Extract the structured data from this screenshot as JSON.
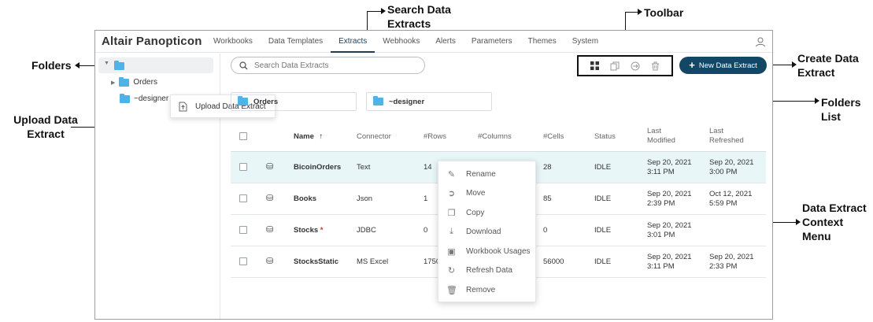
{
  "callouts": {
    "search": "Search Data Extracts",
    "toolbar": "Toolbar",
    "folders": "Folders",
    "create": "Create Data Extract",
    "upload": "Upload Data Extract",
    "folders_list": "Folders List",
    "context_menu": "Data Extract Context Menu"
  },
  "app": {
    "brand": "Altair Panopticon",
    "nav": [
      "Workbooks",
      "Data Templates",
      "Extracts",
      "Webhooks",
      "Alerts",
      "Parameters",
      "Themes",
      "System"
    ],
    "active_nav": "Extracts"
  },
  "sidebar": {
    "folders": [
      "Orders",
      "~designer"
    ]
  },
  "upload_menu": {
    "label": "Upload Data Extract"
  },
  "search": {
    "placeholder": "Search Data Extracts"
  },
  "new_button": {
    "label": "New Data Extract"
  },
  "folder_cards": [
    "Orders",
    "~designer"
  ],
  "table": {
    "headers": {
      "name": "Name",
      "connector": "Connector",
      "rows": "#Rows",
      "columns": "#Columns",
      "cells": "#Cells",
      "status": "Status",
      "last_modified_1": "Last",
      "last_modified_2": "Modified",
      "last_refreshed_1": "Last",
      "last_refreshed_2": "Refreshed"
    },
    "rows": [
      {
        "name": "BicoinOrders",
        "connector": "Text",
        "rows": "14",
        "cells": "28",
        "status": "IDLE",
        "modified_date": "Sep 20, 2021",
        "modified_time": "3:11 PM",
        "refreshed_date": "Sep 20, 2021",
        "refreshed_time": "3:00 PM"
      },
      {
        "name": "Books",
        "connector": "Json",
        "rows": "1",
        "cells": "85",
        "status": "IDLE",
        "modified_date": "Sep 20, 2021",
        "modified_time": "2:39 PM",
        "refreshed_date": "Oct 12, 2021",
        "refreshed_time": "5:59 PM"
      },
      {
        "name": "Stocks",
        "required_mark": "*",
        "connector": "JDBC",
        "rows": "0",
        "cells": "0",
        "status": "IDLE",
        "modified_date": "Sep 20, 2021",
        "modified_time": "3:01 PM",
        "refreshed_date": "",
        "refreshed_time": ""
      },
      {
        "name": "StocksStatic",
        "connector": "MS Excel",
        "rows": "1750",
        "cells": "56000",
        "status": "IDLE",
        "modified_date": "Sep 20, 2021",
        "modified_time": "3:11 PM",
        "refreshed_date": "Sep 20, 2021",
        "refreshed_time": "2:33 PM"
      }
    ]
  },
  "context_menu": {
    "items": [
      "Rename",
      "Move",
      "Copy",
      "Download",
      "Workbook Usages",
      "Refresh Data",
      "Remove"
    ]
  },
  "colors": {
    "accent": "#124766",
    "folder": "#4fb3e8",
    "row_highlight": "#e8f6f8"
  }
}
